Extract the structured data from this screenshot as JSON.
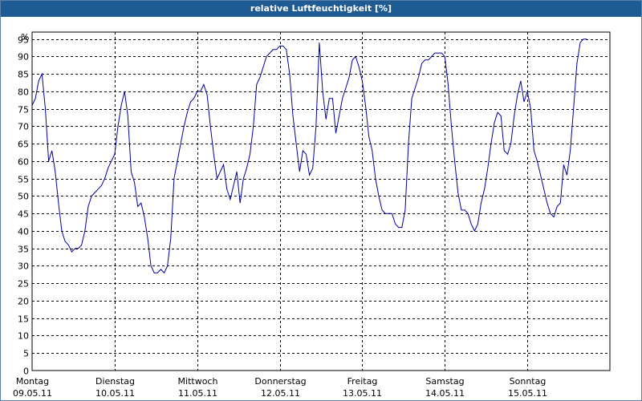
{
  "window": {
    "title": "relative Luftfeuchtigkeit [%]"
  },
  "colors": {
    "titlebar": "#1e5b92",
    "series": "#0000a0",
    "grid": "#000000"
  },
  "chart_data": {
    "type": "line",
    "title": "relative Luftfeuchtigkeit [%]",
    "ylabel": "%",
    "xlabel": "",
    "ylim": [
      0,
      97
    ],
    "yticks": [
      0,
      5,
      10,
      15,
      20,
      25,
      30,
      35,
      40,
      45,
      50,
      55,
      60,
      65,
      70,
      75,
      80,
      85,
      90,
      95
    ],
    "y_unit_label": "%",
    "grid": true,
    "day_labels": [
      {
        "day": "Montag",
        "date": "09.05.11"
      },
      {
        "day": "Dienstag",
        "date": "10.05.11"
      },
      {
        "day": "Mittwoch",
        "date": "11.05.11"
      },
      {
        "day": "Donnerstag",
        "date": "12.05.11"
      },
      {
        "day": "Freitag",
        "date": "13.05.11"
      },
      {
        "day": "Samstag",
        "date": "14.05.11"
      },
      {
        "day": "Sonntag",
        "date": "15.05.11"
      }
    ],
    "series": [
      {
        "values": [
          [
            0.0,
            76
          ],
          [
            0.04,
            78
          ],
          [
            0.08,
            83
          ],
          [
            0.12,
            85
          ],
          [
            0.16,
            75
          ],
          [
            0.2,
            60
          ],
          [
            0.24,
            63
          ],
          [
            0.28,
            57
          ],
          [
            0.32,
            48
          ],
          [
            0.36,
            40
          ],
          [
            0.4,
            37
          ],
          [
            0.44,
            36
          ],
          [
            0.48,
            34
          ],
          [
            0.52,
            35
          ],
          [
            0.56,
            35
          ],
          [
            0.6,
            36
          ],
          [
            0.64,
            40
          ],
          [
            0.68,
            47
          ],
          [
            0.72,
            50
          ],
          [
            0.76,
            51
          ],
          [
            0.8,
            52
          ],
          [
            0.84,
            53
          ],
          [
            0.88,
            55
          ],
          [
            0.92,
            58
          ],
          [
            0.96,
            60
          ],
          [
            1.0,
            62
          ],
          [
            1.04,
            70
          ],
          [
            1.08,
            76
          ],
          [
            1.12,
            80
          ],
          [
            1.16,
            73
          ],
          [
            1.2,
            57
          ],
          [
            1.24,
            54
          ],
          [
            1.28,
            47
          ],
          [
            1.32,
            48
          ],
          [
            1.36,
            44
          ],
          [
            1.4,
            38
          ],
          [
            1.44,
            30
          ],
          [
            1.48,
            28
          ],
          [
            1.52,
            28
          ],
          [
            1.56,
            29
          ],
          [
            1.6,
            28
          ],
          [
            1.64,
            30
          ],
          [
            1.68,
            38
          ],
          [
            1.72,
            55
          ],
          [
            1.76,
            60
          ],
          [
            1.8,
            65
          ],
          [
            1.84,
            70
          ],
          [
            1.88,
            74
          ],
          [
            1.92,
            77
          ],
          [
            1.96,
            78
          ],
          [
            2.0,
            80
          ],
          [
            2.04,
            80
          ],
          [
            2.08,
            82
          ],
          [
            2.12,
            79
          ],
          [
            2.16,
            70
          ],
          [
            2.2,
            62
          ],
          [
            2.24,
            55
          ],
          [
            2.28,
            57
          ],
          [
            2.32,
            59
          ],
          [
            2.36,
            52
          ],
          [
            2.4,
            49
          ],
          [
            2.44,
            53
          ],
          [
            2.48,
            57
          ],
          [
            2.52,
            48
          ],
          [
            2.56,
            55
          ],
          [
            2.6,
            58
          ],
          [
            2.64,
            62
          ],
          [
            2.68,
            70
          ],
          [
            2.72,
            82
          ],
          [
            2.76,
            84
          ],
          [
            2.8,
            87
          ],
          [
            2.84,
            90
          ],
          [
            2.88,
            91
          ],
          [
            2.92,
            92
          ],
          [
            2.96,
            92
          ],
          [
            3.0,
            93
          ],
          [
            3.04,
            93
          ],
          [
            3.08,
            92
          ],
          [
            3.12,
            85
          ],
          [
            3.16,
            73
          ],
          [
            3.2,
            65
          ],
          [
            3.24,
            57
          ],
          [
            3.28,
            63
          ],
          [
            3.32,
            62
          ],
          [
            3.36,
            56
          ],
          [
            3.4,
            58
          ],
          [
            3.44,
            70
          ],
          [
            3.48,
            94
          ],
          [
            3.52,
            80
          ],
          [
            3.56,
            72
          ],
          [
            3.6,
            78
          ],
          [
            3.64,
            78
          ],
          [
            3.68,
            68
          ],
          [
            3.72,
            73
          ],
          [
            3.76,
            78
          ],
          [
            3.8,
            81
          ],
          [
            3.84,
            84
          ],
          [
            3.88,
            89
          ],
          [
            3.92,
            90
          ],
          [
            3.96,
            87
          ],
          [
            4.0,
            83
          ],
          [
            4.04,
            76
          ],
          [
            4.08,
            67
          ],
          [
            4.12,
            63
          ],
          [
            4.16,
            55
          ],
          [
            4.2,
            50
          ],
          [
            4.24,
            46
          ],
          [
            4.28,
            45
          ],
          [
            4.32,
            45
          ],
          [
            4.36,
            45
          ],
          [
            4.4,
            42
          ],
          [
            4.44,
            41
          ],
          [
            4.48,
            41
          ],
          [
            4.52,
            46
          ],
          [
            4.56,
            65
          ],
          [
            4.6,
            78
          ],
          [
            4.64,
            81
          ],
          [
            4.68,
            84
          ],
          [
            4.72,
            88
          ],
          [
            4.76,
            89
          ],
          [
            4.8,
            89
          ],
          [
            4.84,
            90
          ],
          [
            4.88,
            91
          ],
          [
            4.92,
            91
          ],
          [
            4.96,
            91
          ],
          [
            5.0,
            90
          ],
          [
            5.04,
            82
          ],
          [
            5.08,
            70
          ],
          [
            5.12,
            60
          ],
          [
            5.16,
            51
          ],
          [
            5.2,
            46
          ],
          [
            5.24,
            46
          ],
          [
            5.28,
            45
          ],
          [
            5.32,
            42
          ],
          [
            5.36,
            40
          ],
          [
            5.4,
            42
          ],
          [
            5.44,
            48
          ],
          [
            5.48,
            52
          ],
          [
            5.52,
            58
          ],
          [
            5.56,
            65
          ],
          [
            5.6,
            71
          ],
          [
            5.64,
            74
          ],
          [
            5.68,
            73
          ],
          [
            5.72,
            63
          ],
          [
            5.76,
            62
          ],
          [
            5.8,
            65
          ],
          [
            5.84,
            73
          ],
          [
            5.88,
            79
          ],
          [
            5.92,
            83
          ],
          [
            5.96,
            77
          ],
          [
            6.0,
            80
          ],
          [
            6.04,
            75
          ],
          [
            6.08,
            63
          ],
          [
            6.12,
            60
          ],
          [
            6.16,
            56
          ],
          [
            6.2,
            52
          ],
          [
            6.24,
            48
          ],
          [
            6.28,
            45
          ],
          [
            6.32,
            44
          ],
          [
            6.36,
            47
          ],
          [
            6.4,
            48
          ],
          [
            6.44,
            59
          ],
          [
            6.48,
            56
          ],
          [
            6.52,
            63
          ],
          [
            6.56,
            75
          ],
          [
            6.6,
            88
          ],
          [
            6.64,
            94
          ],
          [
            6.68,
            95
          ],
          [
            6.72,
            95
          ]
        ]
      }
    ]
  }
}
